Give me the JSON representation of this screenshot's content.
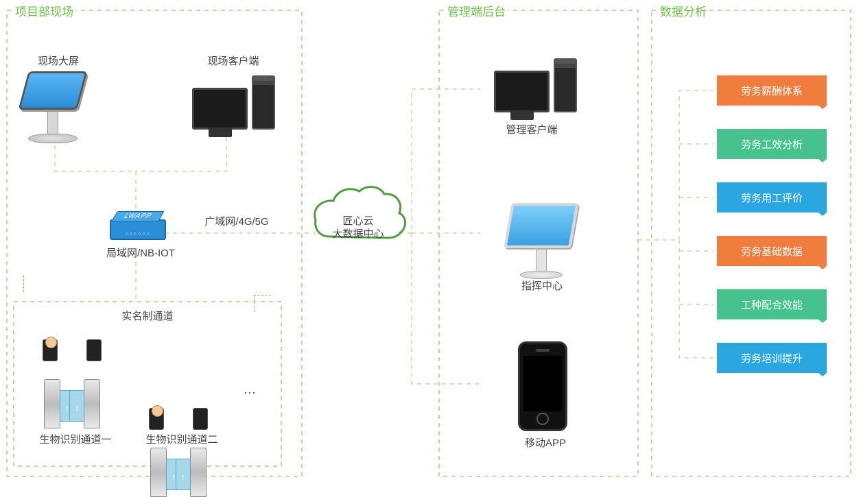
{
  "sections": {
    "site": "项目部现场",
    "backend": "管理端后台",
    "analysis": "数据分析"
  },
  "site": {
    "big_screen": "现场大屏",
    "client": "现场客户端",
    "lan_label": "局域网/NB-IOT",
    "wan_label": "广域网/4G/5G",
    "channel_header": "实名制通道",
    "gate1": "生物识别通道一",
    "gate2": "生物识别通道二",
    "ellipsis": "···"
  },
  "cloud": {
    "line1": "匠心云",
    "line2": "大数据中心"
  },
  "backend": {
    "mgmt_client": "管理客户端",
    "command_center": "指挥中心",
    "mobile_app": "移动APP"
  },
  "analysis": {
    "items": [
      {
        "label": "劳务薪酬体系",
        "color": "orange"
      },
      {
        "label": "劳务工效分析",
        "color": "green"
      },
      {
        "label": "劳务用工评价",
        "color": "blue"
      },
      {
        "label": "劳务基础数据",
        "color": "orange"
      },
      {
        "label": "工种配合效能",
        "color": "green"
      },
      {
        "label": "劳务培训提升",
        "color": "blue"
      }
    ]
  },
  "colors": {
    "green_dash": "#6fbf4a",
    "orange": "#f07d3e",
    "teal": "#45c28d",
    "blue": "#2aa7e0"
  }
}
